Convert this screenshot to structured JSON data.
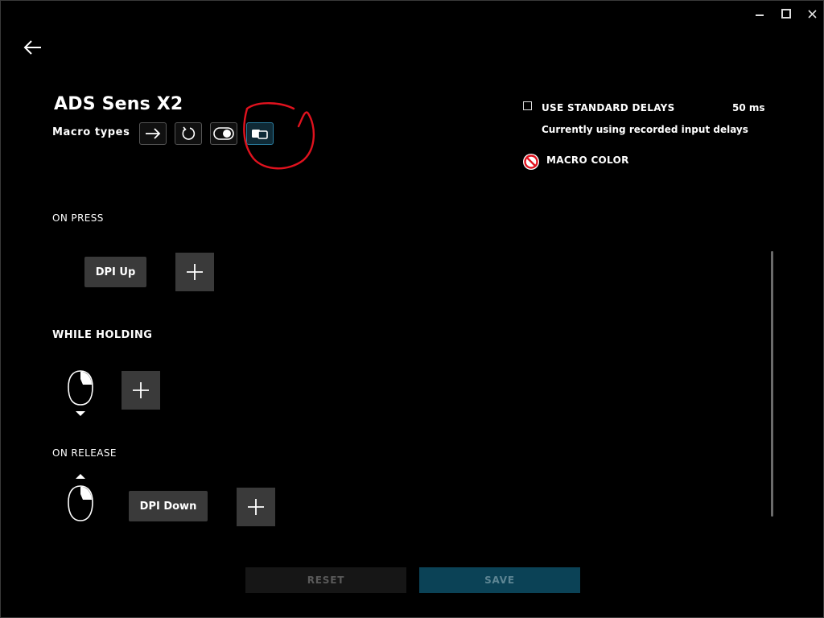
{
  "window": {
    "controls": [
      "minimize",
      "maximize",
      "close"
    ]
  },
  "header": {
    "title": "ADS Sens X2",
    "macro_types_label": "Macro types",
    "macro_types": [
      {
        "icon": "arrow-right-icon",
        "active": false
      },
      {
        "icon": "repeat-icon",
        "active": false
      },
      {
        "icon": "toggle-icon",
        "active": false
      },
      {
        "icon": "hold-icon",
        "active": true
      }
    ]
  },
  "options": {
    "standard_delays_label": "USE STANDARD DELAYS",
    "standard_delays_checked": false,
    "delay_value": "50 ms",
    "delay_note": "Currently using recorded input delays",
    "macro_color_label": "MACRO COLOR"
  },
  "sections": {
    "on_press": {
      "label": "ON PRESS",
      "actions": [
        "DPI Up"
      ]
    },
    "while_holding": {
      "label": "WHILE HOLDING",
      "actions": []
    },
    "on_release": {
      "label": "ON RELEASE",
      "actions": [
        "DPI Down"
      ]
    }
  },
  "footer": {
    "reset_label": "RESET",
    "save_label": "SAVE"
  },
  "colors": {
    "accent": "#0b4256",
    "chip": "#3a3a3a",
    "annotation": "#e0121e"
  }
}
